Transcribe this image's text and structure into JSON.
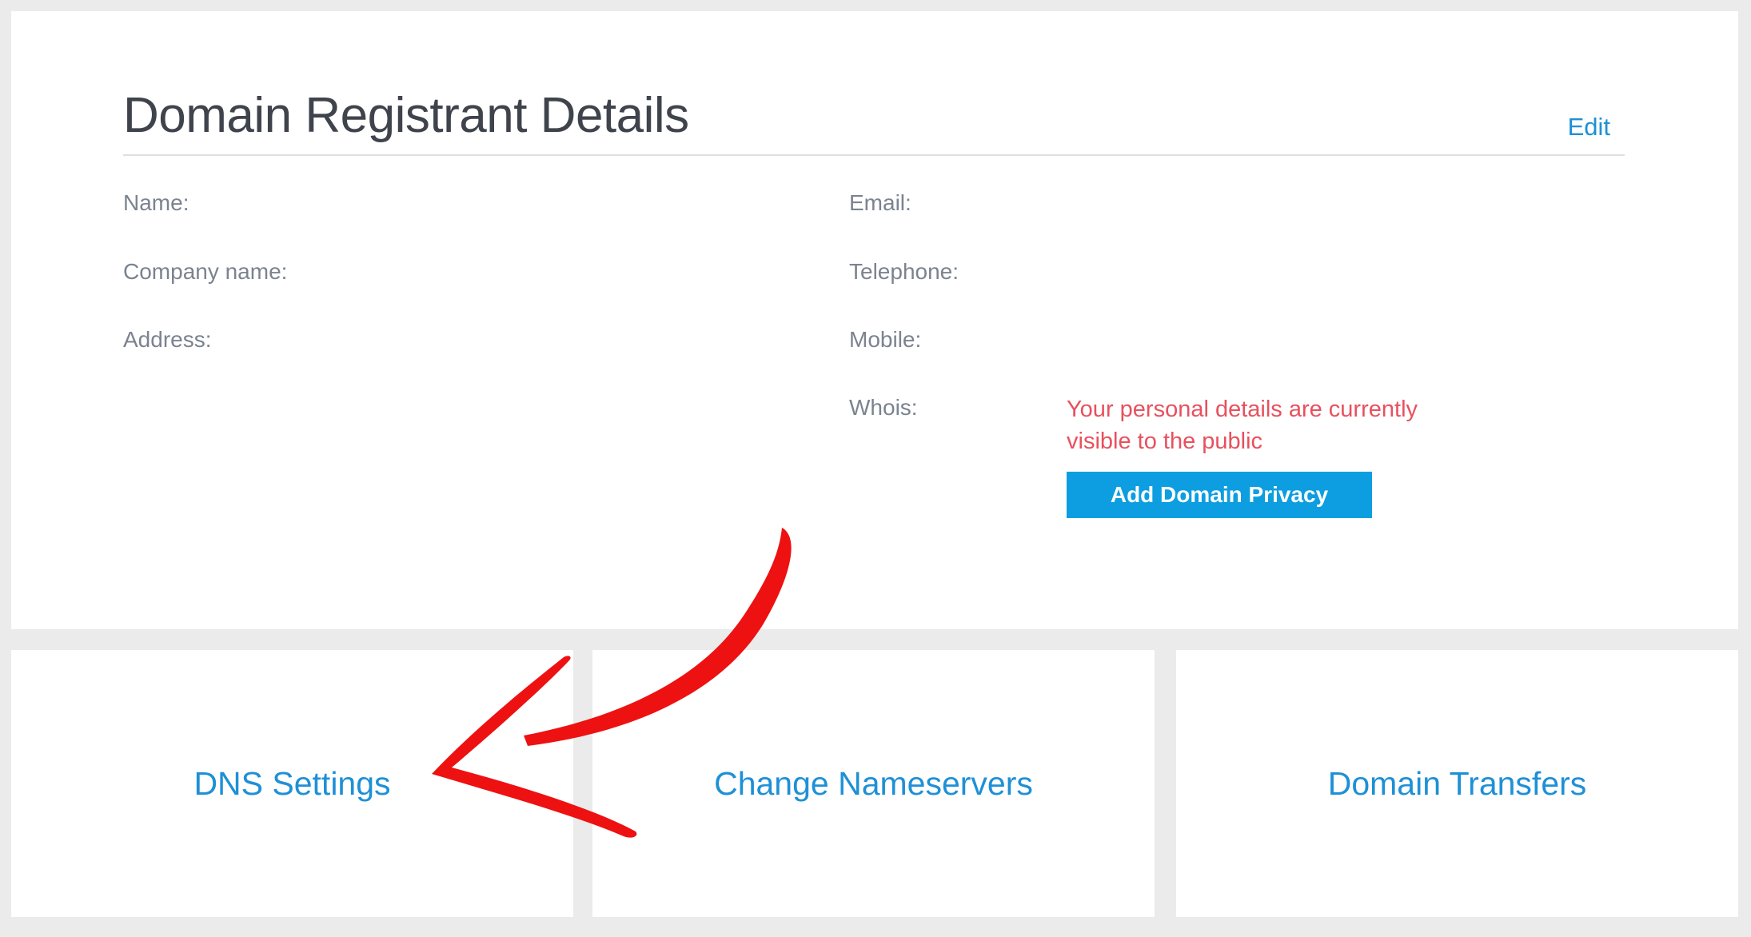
{
  "registrant": {
    "title": "Domain Registrant Details",
    "edit_label": "Edit",
    "labels": {
      "name": "Name:",
      "company": "Company name:",
      "address": "Address:",
      "email": "Email:",
      "telephone": "Telephone:",
      "mobile": "Mobile:",
      "whois": "Whois:"
    },
    "whois_warning": "Your personal details are currently visible to the public",
    "privacy_button_label": "Add Domain Privacy"
  },
  "tiles": [
    {
      "label": "DNS Settings"
    },
    {
      "label": "Change Nameservers"
    },
    {
      "label": "Domain Transfers"
    }
  ],
  "colors": {
    "accent": "#1e90d6",
    "button": "#0c9ee0",
    "warning": "#e8505e",
    "annotation_arrow": "#ee1111",
    "background": "#ebebeb"
  }
}
